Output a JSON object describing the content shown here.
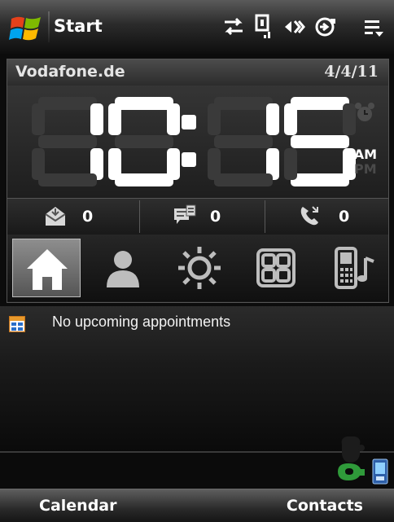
{
  "titlebar": {
    "start_label": "Start",
    "icons": [
      "windows-logo",
      "connectivity-icon",
      "signal-icon",
      "volume-off-icon",
      "battery-charging-icon",
      "menu-icon"
    ]
  },
  "clock_panel": {
    "carrier": "Vodafone.de",
    "date": "4/4/11",
    "time": "10:15",
    "am_label": "AM",
    "pm_label": "PM",
    "active_period": "AM",
    "counters": [
      {
        "icon": "email-icon",
        "value": "0"
      },
      {
        "icon": "sms-icon",
        "value": "0"
      },
      {
        "icon": "missed-call-icon",
        "value": "0"
      }
    ],
    "tabs": [
      {
        "icon": "home-icon",
        "active": true
      },
      {
        "icon": "person-icon",
        "active": false
      },
      {
        "icon": "weather-sun-icon",
        "active": false
      },
      {
        "icon": "apps-grid-icon",
        "active": false
      },
      {
        "icon": "phone-music-icon",
        "active": false
      }
    ]
  },
  "main": {
    "appointment_text": "No upcoming appointments"
  },
  "softkeys": {
    "left": "Calendar",
    "right": "Contacts"
  },
  "colors": {
    "background": "#0c0c0c",
    "digit_on": "#ffffff",
    "digit_off": "#3a3a3a",
    "accent_green": "#2f9a3a"
  }
}
